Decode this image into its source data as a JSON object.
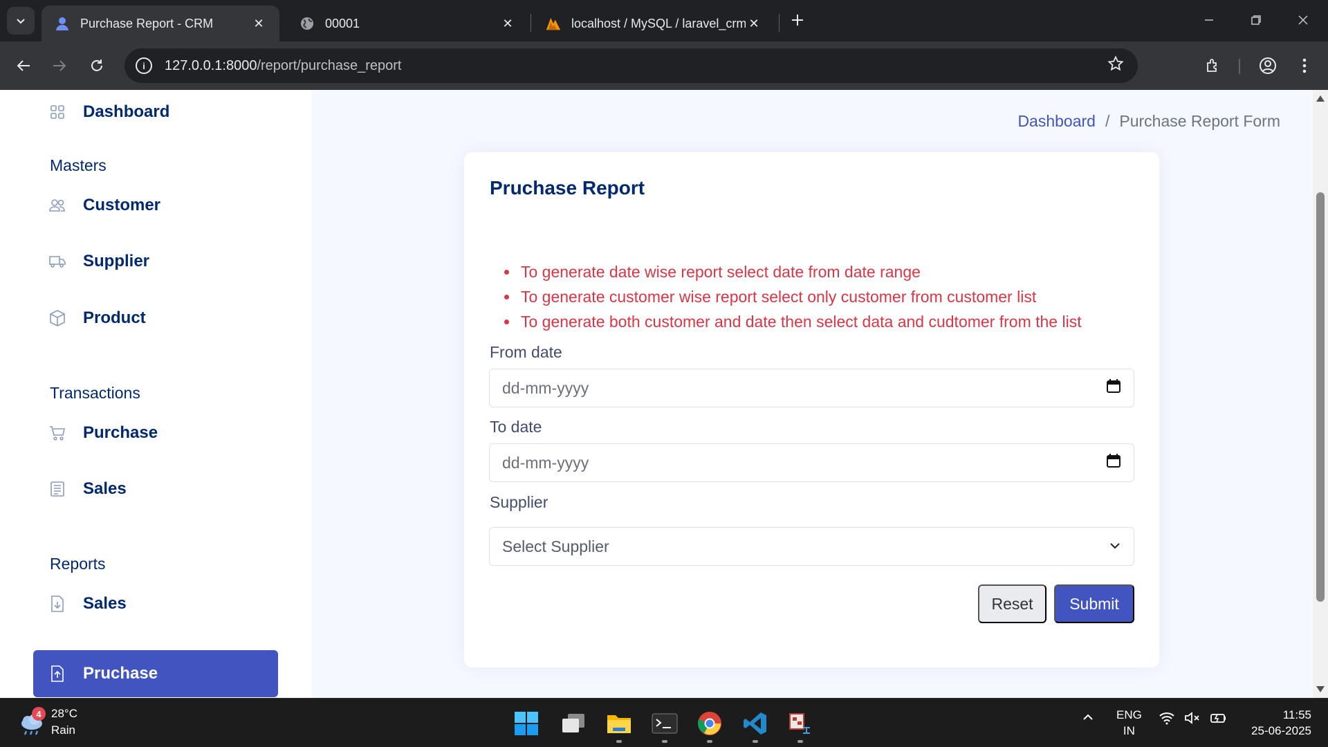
{
  "browser": {
    "tabs": [
      {
        "title": "Purchase Report - CRM",
        "active": true
      },
      {
        "title": "00001",
        "active": false
      },
      {
        "title": "localhost / MySQL / laravel_crm",
        "active": false
      }
    ],
    "url_host": "127.0.0.1:8000",
    "url_path": "/report/purchase_report"
  },
  "sidebar": {
    "dashboard": "Dashboard",
    "masters_heading": "Masters",
    "customer": "Customer",
    "supplier": "Supplier",
    "product": "Product",
    "transactions_heading": "Transactions",
    "purchase": "Purchase",
    "sales": "Sales",
    "reports_heading": "Reports",
    "report_sales": "Sales",
    "report_purchase": "Pruchase"
  },
  "breadcrumb": {
    "home": "Dashboard",
    "separator": "/",
    "current": "Purchase Report Form"
  },
  "card": {
    "title": "Pruchase Report",
    "notes": [
      "To generate date wise report select date from date range",
      "To generate customer wise report select only customer from customer list",
      "To generate both customer and date then select data and cudtomer from the list"
    ],
    "from_label": "From date",
    "from_placeholder": "dd-mm-yyyy",
    "to_label": "To date",
    "to_placeholder": "dd-mm-yyyy",
    "supplier_label": "Supplier",
    "supplier_selected": "Select Supplier",
    "reset_label": "Reset",
    "submit_label": "Submit"
  },
  "taskbar": {
    "weather_badge": "4",
    "temperature": "28°C",
    "condition": "Rain",
    "lang_1": "ENG",
    "lang_2": "IN",
    "time": "11:55",
    "date": "25-06-2025"
  },
  "colors": {
    "accent": "#4154c0",
    "heading": "#012970",
    "danger": "#dc3545",
    "page_bg": "#f5f8ff"
  }
}
